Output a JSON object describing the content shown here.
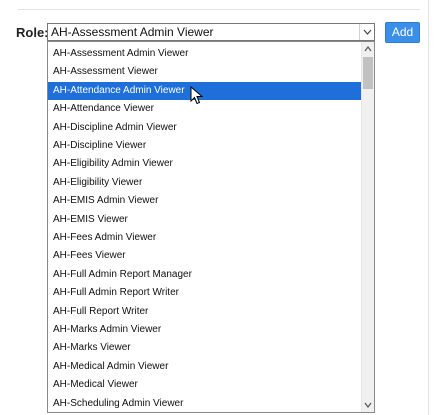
{
  "form": {
    "role_label": "Role:",
    "selected_value": "AH-Assessment Admin Viewer",
    "add_button_label": "Add"
  },
  "dropdown": {
    "options": [
      "AH-Assessment Admin Viewer",
      "AH-Assessment Viewer",
      "AH-Attendance Admin Viewer",
      "AH-Attendance Viewer",
      "AH-Discipline Admin Viewer",
      "AH-Discipline Viewer",
      "AH-Eligibility Admin Viewer",
      "AH-Eligibility Viewer",
      "AH-EMIS Admin Viewer",
      "AH-EMIS Viewer",
      "AH-Fees Admin Viewer",
      "AH-Fees Viewer",
      "AH-Full Admin Report Manager",
      "AH-Full Admin Report Writer",
      "AH-Full Report Writer",
      "AH-Marks Admin Viewer",
      "AH-Marks Viewer",
      "AH-Medical Admin Viewer",
      "AH-Medical Viewer",
      "AH-Scheduling Admin Viewer"
    ],
    "hovered_option": "AH-Attendance Admin Viewer"
  },
  "icons": {
    "select_arrow": "chevron-down-icon",
    "scroll_up": "chevron-up-icon",
    "scroll_down": "chevron-down-icon",
    "cursor": "mouse-pointer-icon"
  },
  "colors": {
    "highlight": "#1e6fd9",
    "add_button": "#3b8fe8"
  }
}
